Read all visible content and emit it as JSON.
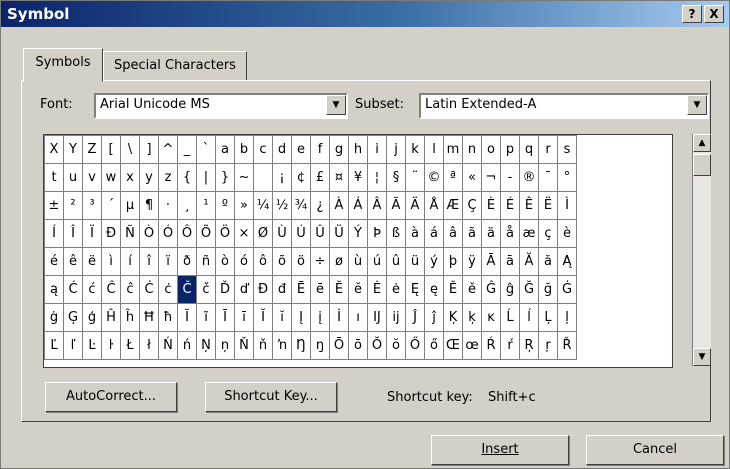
{
  "window": {
    "title": "Symbol",
    "help_button": "?",
    "close_button": "X"
  },
  "tabs": [
    {
      "label": "Symbols",
      "active": true
    },
    {
      "label": "Special Characters",
      "active": false
    }
  ],
  "font": {
    "label": "Font:",
    "value": "Arial Unicode MS"
  },
  "subset": {
    "label": "Subset:",
    "value": "Latin Extended-A"
  },
  "symbol_grid": {
    "rows": [
      [
        "X",
        "Y",
        "Z",
        "[",
        "\\",
        "]",
        "^",
        "_",
        "`",
        "a",
        "b",
        "c",
        "d",
        "e",
        "f",
        "g",
        "h",
        "i",
        "j",
        "k",
        "l",
        "m",
        "n",
        "o",
        "p",
        "q",
        "r",
        "s"
      ],
      [
        "t",
        "u",
        "v",
        "w",
        "x",
        "y",
        "z",
        "{",
        "|",
        "}",
        "~",
        " ",
        "¡",
        "¢",
        "£",
        "¤",
        "¥",
        "¦",
        "§",
        "¨",
        "©",
        "ª",
        "«",
        "¬",
        "-",
        "®",
        "¯",
        "°"
      ],
      [
        "±",
        "²",
        "³",
        "´",
        "µ",
        "¶",
        "·",
        "¸",
        "¹",
        "º",
        "»",
        "¼",
        "½",
        "¾",
        "¿",
        "À",
        "Á",
        "Â",
        "Ã",
        "Ä",
        "Å",
        "Æ",
        "Ç",
        "È",
        "É",
        "Ê",
        "Ë",
        "Ì"
      ],
      [
        "Í",
        "Î",
        "Ï",
        "Ð",
        "Ñ",
        "Ò",
        "Ó",
        "Ô",
        "Õ",
        "Ö",
        "×",
        "Ø",
        "Ù",
        "Ú",
        "Û",
        "Ü",
        "Ý",
        "Þ",
        "ß",
        "à",
        "á",
        "â",
        "ã",
        "ä",
        "å",
        "æ",
        "ç",
        "è"
      ],
      [
        "é",
        "ê",
        "ë",
        "ì",
        "í",
        "î",
        "ï",
        "ð",
        "ñ",
        "ò",
        "ó",
        "ô",
        "õ",
        "ö",
        "÷",
        "ø",
        "ù",
        "ú",
        "û",
        "ü",
        "ý",
        "þ",
        "ÿ",
        "Ā",
        "ā",
        "Ă",
        "ă",
        "Ą"
      ],
      [
        "ą",
        "Ć",
        "ć",
        "Ĉ",
        "ĉ",
        "Ċ",
        "ċ",
        "Č",
        "č",
        "Ď",
        "ď",
        "Đ",
        "đ",
        "Ē",
        "ē",
        "Ĕ",
        "ĕ",
        "Ė",
        "ė",
        "Ę",
        "ę",
        "Ě",
        "ě",
        "Ĝ",
        "ĝ",
        "Ğ",
        "ğ",
        "Ġ"
      ],
      [
        "ġ",
        "Ģ",
        "ģ",
        "Ĥ",
        "ĥ",
        "Ħ",
        "ħ",
        "Ĩ",
        "ĩ",
        "Ī",
        "ī",
        "Ĭ",
        "ĭ",
        "Į",
        "į",
        "İ",
        "ı",
        "Ĳ",
        "ĳ",
        "Ĵ",
        "ĵ",
        "Ķ",
        "ķ",
        "ĸ",
        "Ĺ",
        "ĺ",
        "Ļ",
        "ļ"
      ],
      [
        "Ľ",
        "ľ",
        "Ŀ",
        "ŀ",
        "Ł",
        "ł",
        "Ń",
        "ń",
        "Ņ",
        "ņ",
        "Ň",
        "ň",
        "ŉ",
        "Ŋ",
        "ŋ",
        "Ō",
        "ō",
        "Ŏ",
        "ŏ",
        "Ő",
        "ő",
        "Œ",
        "œ",
        "Ŕ",
        "ŕ",
        "Ŗ",
        "ŗ",
        "Ř"
      ]
    ],
    "selected": {
      "row": 5,
      "col": 7
    }
  },
  "buttons": {
    "autocorrect": "AutoCorrect...",
    "shortcut_key": "Shortcut Key...",
    "insert": "Insert",
    "cancel": "Cancel"
  },
  "shortcut": {
    "label": "Shortcut key:",
    "value": "Shift+c"
  },
  "colors": {
    "title_active": "#0a246a",
    "selection": "#0a246a",
    "face": "#d4d0c8"
  }
}
